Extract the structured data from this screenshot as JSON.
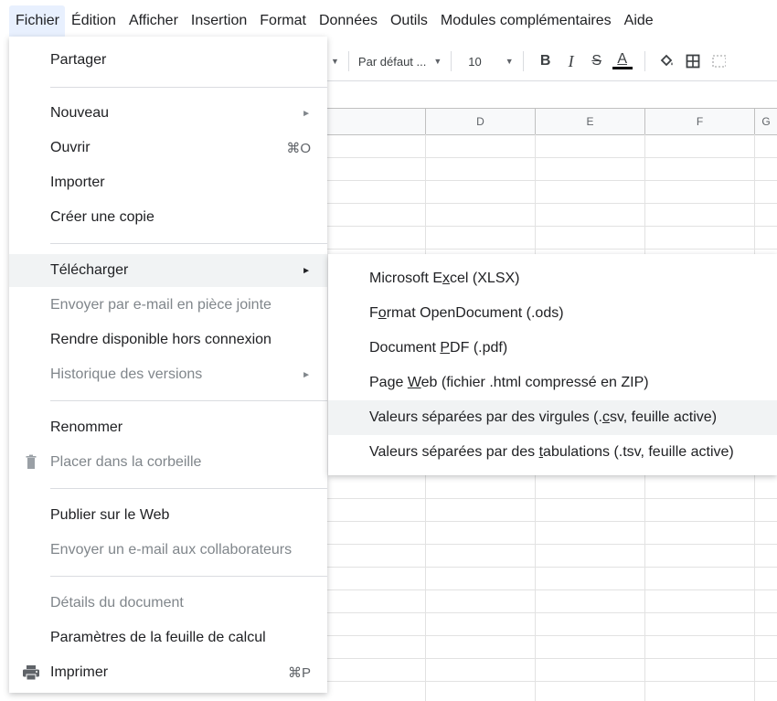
{
  "menubar": {
    "items": [
      "Fichier",
      "Édition",
      "Afficher",
      "Insertion",
      "Format",
      "Données",
      "Outils",
      "Modules complémentaires",
      "Aide"
    ]
  },
  "toolbar": {
    "font": "Par défaut ...",
    "size": "10",
    "bold": "B",
    "italic": "I",
    "strike": "S",
    "textcolor": "A"
  },
  "grid": {
    "columns": [
      "D",
      "E",
      "F",
      "G"
    ]
  },
  "file_menu": {
    "share": "Partager",
    "new": "Nouveau",
    "open": "Ouvrir",
    "open_shortcut": "⌘O",
    "import": "Importer",
    "copy": "Créer une copie",
    "download": "Télécharger",
    "email_attach": "Envoyer par e-mail en pièce jointe",
    "offline": "Rendre disponible hors connexion",
    "versions": "Historique des versions",
    "rename": "Renommer",
    "trash": "Placer dans la corbeille",
    "publish": "Publier sur le Web",
    "email_collab": "Envoyer un e-mail aux collaborateurs",
    "details": "Détails du document",
    "settings": "Paramètres de la feuille de calcul",
    "print": "Imprimer",
    "print_shortcut": "⌘P"
  },
  "download_submenu": {
    "xlsx": {
      "before": "Microsoft E",
      "key": "x",
      "after": "cel (XLSX)"
    },
    "ods": {
      "before": "F",
      "key": "o",
      "after": "rmat OpenDocument (.ods)"
    },
    "pdf": {
      "before": "Document ",
      "key": "P",
      "after": "DF (.pdf)"
    },
    "html": {
      "before": "Page ",
      "key": "W",
      "after": "eb (fichier .html compressé en ZIP)"
    },
    "csv": {
      "before": "Valeurs séparées par des virgules (.",
      "key": "c",
      "after": "sv, feuille active)"
    },
    "tsv": {
      "before": "Valeurs séparées par des ",
      "key": "t",
      "after": "abulations (.tsv, feuille active)"
    }
  },
  "colors": {
    "active_menu": "#e8f0fe",
    "hover": "#f1f3f4",
    "disabled": "#80868b"
  }
}
